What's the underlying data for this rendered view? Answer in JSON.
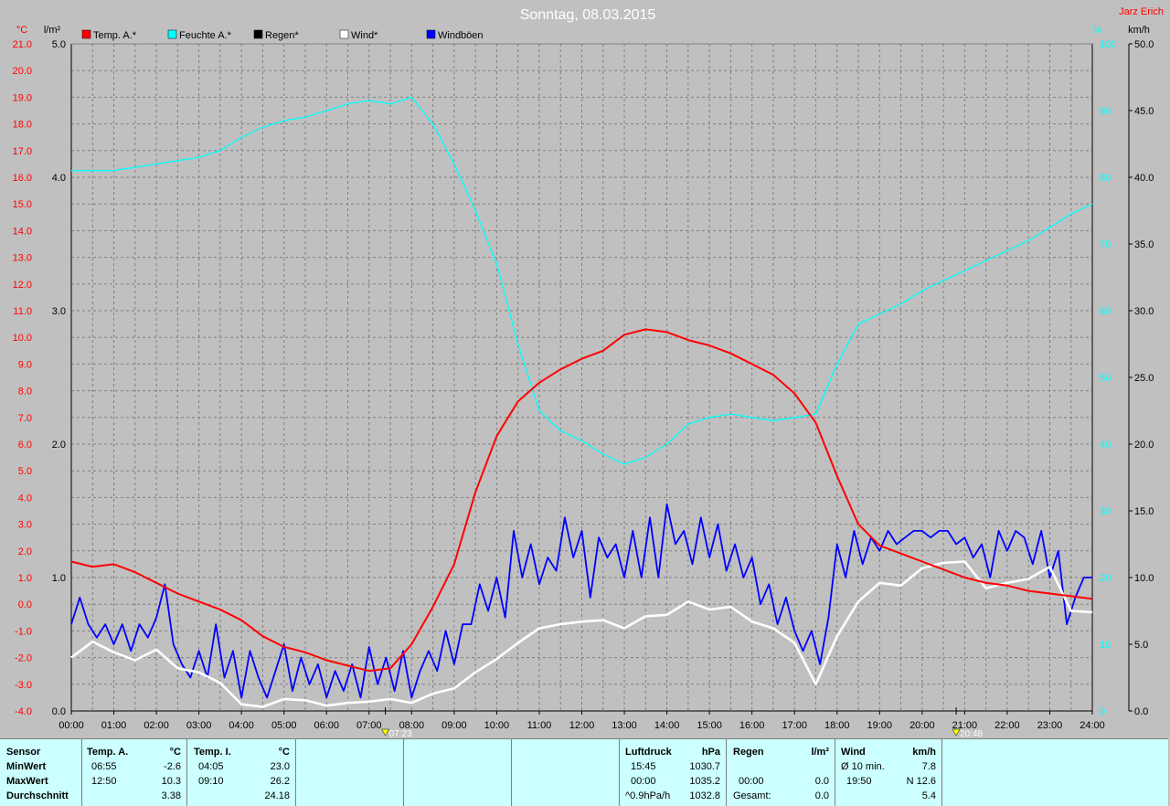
{
  "title": "Sonntag, 08.03.2015",
  "author": "Jarz Erich",
  "colors": {
    "background": "#c0c0c0",
    "temp": "#ff0000",
    "humidity": "#00ffff",
    "rain": "#000000",
    "wind": "#ffffff",
    "gusts": "#0000ff",
    "stats_bg": "#ccffff"
  },
  "chart_data": {
    "type": "line",
    "title": "Sonntag, 08.03.2015",
    "x_tick_labels": [
      "00:00",
      "01:00",
      "02:00",
      "03:00",
      "04:00",
      "05:00",
      "06:00",
      "07:00",
      "08:00",
      "09:00",
      "10:00",
      "11:00",
      "12:00",
      "13:00",
      "14:00",
      "15:00",
      "16:00",
      "17:00",
      "18:00",
      "19:00",
      "20:00",
      "21:00",
      "22:00",
      "23:00",
      "24:00"
    ],
    "xlim_hours": [
      0,
      24
    ],
    "grid": true,
    "axes": {
      "temp": {
        "unit": "°C",
        "range": [
          -4,
          21
        ],
        "ticks": [
          "-4.0",
          "-3.0",
          "-2.0",
          "-1.0",
          "0.0",
          "1.0",
          "2.0",
          "3.0",
          "4.0",
          "5.0",
          "6.0",
          "7.0",
          "8.0",
          "9.0",
          "10.0",
          "11.0",
          "12.0",
          "13.0",
          "14.0",
          "15.0",
          "16.0",
          "17.0",
          "18.0",
          "19.0",
          "20.0",
          "21.0"
        ]
      },
      "rain": {
        "unit": "l/m²",
        "range": [
          0,
          5
        ],
        "ticks": [
          "0.0",
          "1.0",
          "2.0",
          "3.0",
          "4.0",
          "5.0"
        ]
      },
      "humidity": {
        "unit": "%",
        "range": [
          0,
          100
        ],
        "ticks": [
          "0",
          "10",
          "20",
          "30",
          "40",
          "50",
          "60",
          "70",
          "80",
          "90",
          "100"
        ]
      },
      "wind": {
        "unit": "km/h",
        "range": [
          0,
          50
        ],
        "ticks": [
          "0.0",
          "5.0",
          "10.0",
          "15.0",
          "20.0",
          "25.0",
          "30.0",
          "35.0",
          "40.0",
          "45.0",
          "50.0"
        ]
      }
    },
    "legend": [
      "Temp. A.*",
      "Feuchte A.*",
      "Regen*",
      "Wind*",
      "Windböen"
    ],
    "sun_markers": [
      "07:23",
      "20:48"
    ],
    "series": [
      {
        "name": "Temp. A.*",
        "axis": "temp",
        "color": "#ff0000",
        "points": [
          [
            0,
            1.6
          ],
          [
            0.5,
            1.4
          ],
          [
            1,
            1.5
          ],
          [
            1.5,
            1.2
          ],
          [
            2,
            0.8
          ],
          [
            2.5,
            0.4
          ],
          [
            3,
            0.1
          ],
          [
            3.5,
            -0.2
          ],
          [
            4,
            -0.6
          ],
          [
            4.5,
            -1.2
          ],
          [
            5,
            -1.6
          ],
          [
            5.5,
            -1.8
          ],
          [
            6,
            -2.1
          ],
          [
            6.5,
            -2.3
          ],
          [
            7,
            -2.5
          ],
          [
            7.5,
            -2.4
          ],
          [
            8,
            -1.5
          ],
          [
            8.5,
            -0.1
          ],
          [
            9,
            1.5
          ],
          [
            9.5,
            4.2
          ],
          [
            10,
            6.3
          ],
          [
            10.5,
            7.6
          ],
          [
            11,
            8.3
          ],
          [
            11.5,
            8.8
          ],
          [
            12,
            9.2
          ],
          [
            12.5,
            9.5
          ],
          [
            13,
            10.1
          ],
          [
            13.5,
            10.3
          ],
          [
            14,
            10.2
          ],
          [
            14.5,
            9.9
          ],
          [
            15,
            9.7
          ],
          [
            15.5,
            9.4
          ],
          [
            16,
            9.0
          ],
          [
            16.5,
            8.6
          ],
          [
            17,
            7.9
          ],
          [
            17.5,
            6.8
          ],
          [
            18,
            4.8
          ],
          [
            18.5,
            3.0
          ],
          [
            19,
            2.2
          ],
          [
            19.5,
            1.9
          ],
          [
            20,
            1.6
          ],
          [
            20.5,
            1.3
          ],
          [
            21,
            1.0
          ],
          [
            21.5,
            0.8
          ],
          [
            22,
            0.7
          ],
          [
            22.5,
            0.5
          ],
          [
            23,
            0.4
          ],
          [
            23.5,
            0.3
          ],
          [
            24,
            0.2
          ]
        ]
      },
      {
        "name": "Feuchte A.*",
        "axis": "humidity",
        "color": "#00ffff",
        "points": [
          [
            0,
            81
          ],
          [
            0.5,
            81
          ],
          [
            1,
            81
          ],
          [
            1.5,
            81.5
          ],
          [
            2,
            82
          ],
          [
            2.5,
            82.5
          ],
          [
            3,
            83
          ],
          [
            3.5,
            84
          ],
          [
            4,
            86
          ],
          [
            4.5,
            87.5
          ],
          [
            5,
            88.5
          ],
          [
            5.5,
            89
          ],
          [
            6,
            90
          ],
          [
            6.5,
            91
          ],
          [
            7,
            91.5
          ],
          [
            7.5,
            91
          ],
          [
            8,
            92
          ],
          [
            8.5,
            88
          ],
          [
            9,
            82
          ],
          [
            9.5,
            75
          ],
          [
            10,
            67
          ],
          [
            10.5,
            55
          ],
          [
            11,
            45
          ],
          [
            11.5,
            42
          ],
          [
            12,
            40.5
          ],
          [
            12.5,
            38.5
          ],
          [
            13,
            37
          ],
          [
            13.5,
            38
          ],
          [
            14,
            40
          ],
          [
            14.5,
            43
          ],
          [
            15,
            44
          ],
          [
            15.5,
            44.5
          ],
          [
            16,
            44
          ],
          [
            16.5,
            43.5
          ],
          [
            17,
            44
          ],
          [
            17.5,
            44.5
          ],
          [
            18,
            52
          ],
          [
            18.5,
            58
          ],
          [
            19,
            59.5
          ],
          [
            19.5,
            61
          ],
          [
            20,
            63
          ],
          [
            20.5,
            64.5
          ],
          [
            21,
            66
          ],
          [
            21.5,
            67.5
          ],
          [
            22,
            69
          ],
          [
            22.5,
            70.5
          ],
          [
            23,
            72.5
          ],
          [
            23.5,
            74.5
          ],
          [
            24,
            76
          ]
        ]
      },
      {
        "name": "Regen*",
        "axis": "rain",
        "color": "#000000",
        "points": [
          [
            0,
            0
          ],
          [
            24,
            0
          ]
        ]
      },
      {
        "name": "Wind*",
        "axis": "wind",
        "color": "#ffffff",
        "points": [
          [
            0,
            4
          ],
          [
            0.5,
            5.2
          ],
          [
            1,
            4.4
          ],
          [
            1.5,
            3.8
          ],
          [
            2,
            4.6
          ],
          [
            2.5,
            3.2
          ],
          [
            3,
            2.9
          ],
          [
            3.5,
            2.1
          ],
          [
            4,
            0.5
          ],
          [
            4.5,
            0.3
          ],
          [
            5,
            0.9
          ],
          [
            5.5,
            0.8
          ],
          [
            6,
            0.4
          ],
          [
            6.5,
            0.6
          ],
          [
            7,
            0.7
          ],
          [
            7.5,
            0.9
          ],
          [
            8,
            0.6
          ],
          [
            8.5,
            1.3
          ],
          [
            9,
            1.7
          ],
          [
            9.5,
            2.9
          ],
          [
            10,
            3.9
          ],
          [
            10.5,
            5.1
          ],
          [
            11,
            6.2
          ],
          [
            11.5,
            6.5
          ],
          [
            12,
            6.7
          ],
          [
            12.5,
            6.8
          ],
          [
            13,
            6.2
          ],
          [
            13.5,
            7.1
          ],
          [
            14,
            7.2
          ],
          [
            14.5,
            8.2
          ],
          [
            15,
            7.6
          ],
          [
            15.5,
            7.8
          ],
          [
            16,
            6.7
          ],
          [
            16.5,
            6.2
          ],
          [
            17,
            5.1
          ],
          [
            17.5,
            2.0
          ],
          [
            18,
            5.6
          ],
          [
            18.5,
            8.2
          ],
          [
            19,
            9.6
          ],
          [
            19.5,
            9.4
          ],
          [
            20,
            10.7
          ],
          [
            20.5,
            11.1
          ],
          [
            21,
            11.2
          ],
          [
            21.5,
            9.2
          ],
          [
            22,
            9.6
          ],
          [
            22.5,
            9.9
          ],
          [
            23,
            10.8
          ],
          [
            23.5,
            7.5
          ],
          [
            24,
            7.4
          ]
        ]
      },
      {
        "name": "Windböen",
        "axis": "wind",
        "color": "#0000ff",
        "points": [
          [
            0,
            6.5
          ],
          [
            0.2,
            8.5
          ],
          [
            0.4,
            6.5
          ],
          [
            0.6,
            5.5
          ],
          [
            0.8,
            6.5
          ],
          [
            1,
            5
          ],
          [
            1.2,
            6.5
          ],
          [
            1.4,
            4.5
          ],
          [
            1.6,
            6.5
          ],
          [
            1.8,
            5.5
          ],
          [
            2,
            7
          ],
          [
            2.2,
            9.5
          ],
          [
            2.4,
            5
          ],
          [
            2.6,
            3.5
          ],
          [
            2.8,
            2.5
          ],
          [
            3,
            4.5
          ],
          [
            3.2,
            2.5
          ],
          [
            3.4,
            6.5
          ],
          [
            3.6,
            2.5
          ],
          [
            3.8,
            4.5
          ],
          [
            4,
            1
          ],
          [
            4.2,
            4.5
          ],
          [
            4.4,
            2.5
          ],
          [
            4.6,
            1
          ],
          [
            4.8,
            3
          ],
          [
            5,
            5
          ],
          [
            5.2,
            1.5
          ],
          [
            5.4,
            4
          ],
          [
            5.6,
            2
          ],
          [
            5.8,
            3.5
          ],
          [
            6,
            1
          ],
          [
            6.2,
            3
          ],
          [
            6.4,
            1.5
          ],
          [
            6.6,
            3.5
          ],
          [
            6.8,
            1
          ],
          [
            7,
            4.8
          ],
          [
            7.2,
            2
          ],
          [
            7.4,
            4
          ],
          [
            7.6,
            1.5
          ],
          [
            7.8,
            4.5
          ],
          [
            8,
            1
          ],
          [
            8.2,
            3
          ],
          [
            8.4,
            4.5
          ],
          [
            8.6,
            3
          ],
          [
            8.8,
            6
          ],
          [
            9,
            3.5
          ],
          [
            9.2,
            6.5
          ],
          [
            9.4,
            6.5
          ],
          [
            9.6,
            9.5
          ],
          [
            9.8,
            7.5
          ],
          [
            10,
            10
          ],
          [
            10.2,
            7
          ],
          [
            10.4,
            13.5
          ],
          [
            10.6,
            10
          ],
          [
            10.8,
            12.5
          ],
          [
            11,
            9.5
          ],
          [
            11.2,
            11.5
          ],
          [
            11.4,
            10.5
          ],
          [
            11.6,
            14.5
          ],
          [
            11.8,
            11.5
          ],
          [
            12,
            13.5
          ],
          [
            12.2,
            8.5
          ],
          [
            12.4,
            13
          ],
          [
            12.6,
            11.5
          ],
          [
            12.8,
            12.5
          ],
          [
            13,
            10
          ],
          [
            13.2,
            13.5
          ],
          [
            13.4,
            10
          ],
          [
            13.6,
            14.5
          ],
          [
            13.8,
            10
          ],
          [
            14,
            15.5
          ],
          [
            14.2,
            12.5
          ],
          [
            14.4,
            13.5
          ],
          [
            14.6,
            11
          ],
          [
            14.8,
            14.5
          ],
          [
            15,
            11.5
          ],
          [
            15.2,
            14
          ],
          [
            15.4,
            10.5
          ],
          [
            15.6,
            12.5
          ],
          [
            15.8,
            10
          ],
          [
            16,
            11.5
          ],
          [
            16.2,
            8
          ],
          [
            16.4,
            9.5
          ],
          [
            16.6,
            6.5
          ],
          [
            16.8,
            8.5
          ],
          [
            17,
            6
          ],
          [
            17.2,
            4.5
          ],
          [
            17.4,
            6
          ],
          [
            17.6,
            3.5
          ],
          [
            17.8,
            7
          ],
          [
            18,
            12.5
          ],
          [
            18.2,
            10
          ],
          [
            18.4,
            13.5
          ],
          [
            18.6,
            11
          ],
          [
            18.8,
            13
          ],
          [
            19,
            12
          ],
          [
            19.2,
            13.5
          ],
          [
            19.4,
            12.5
          ],
          [
            19.6,
            13
          ],
          [
            19.8,
            13.5
          ],
          [
            20,
            13.5
          ],
          [
            20.2,
            13
          ],
          [
            20.4,
            13.5
          ],
          [
            20.6,
            13.5
          ],
          [
            20.8,
            12.5
          ],
          [
            21,
            13
          ],
          [
            21.2,
            11.5
          ],
          [
            21.4,
            12.5
          ],
          [
            21.6,
            10
          ],
          [
            21.8,
            13.5
          ],
          [
            22,
            12
          ],
          [
            22.2,
            13.5
          ],
          [
            22.4,
            13
          ],
          [
            22.6,
            11
          ],
          [
            22.8,
            13.5
          ],
          [
            23,
            10
          ],
          [
            23.2,
            12
          ],
          [
            23.4,
            6.5
          ],
          [
            23.6,
            8.5
          ],
          [
            23.8,
            10
          ],
          [
            24,
            10
          ]
        ]
      }
    ]
  },
  "stats": {
    "sensor_header": "Sensor",
    "row_labels": [
      "MinWert",
      "MaxWert",
      "Durchschnitt"
    ],
    "temp_a": {
      "header": "Temp. A.",
      "unit": "°C",
      "min_time": "06:55",
      "min_val": "-2.6",
      "max_time": "12:50",
      "max_val": "10.3",
      "avg": "3.38"
    },
    "temp_i": {
      "header": "Temp. I.",
      "unit": "°C",
      "min_time": "04:05",
      "min_val": "23.0",
      "max_time": "09:10",
      "max_val": "26.2",
      "avg": "24.18"
    },
    "pressure": {
      "header": "Luftdruck",
      "unit": "hPa",
      "min_time": "15:45",
      "min_val": "1030.7",
      "max_time": "00:00",
      "max_val": "1035.2",
      "trend": "^0.9hPa/h",
      "avg": "1032.8"
    },
    "rain": {
      "header": "Regen",
      "unit": "l/m²",
      "max_time": "00:00",
      "max_val": "0.0",
      "total_label": "Gesamt:",
      "total": "0.0"
    },
    "wind": {
      "header": "Wind",
      "unit": "km/h",
      "avg10_label": "Ø 10 min.",
      "avg10": "7.8",
      "max_time": "19:50",
      "max_val": "N 12.6",
      "avg": "5.4"
    }
  }
}
